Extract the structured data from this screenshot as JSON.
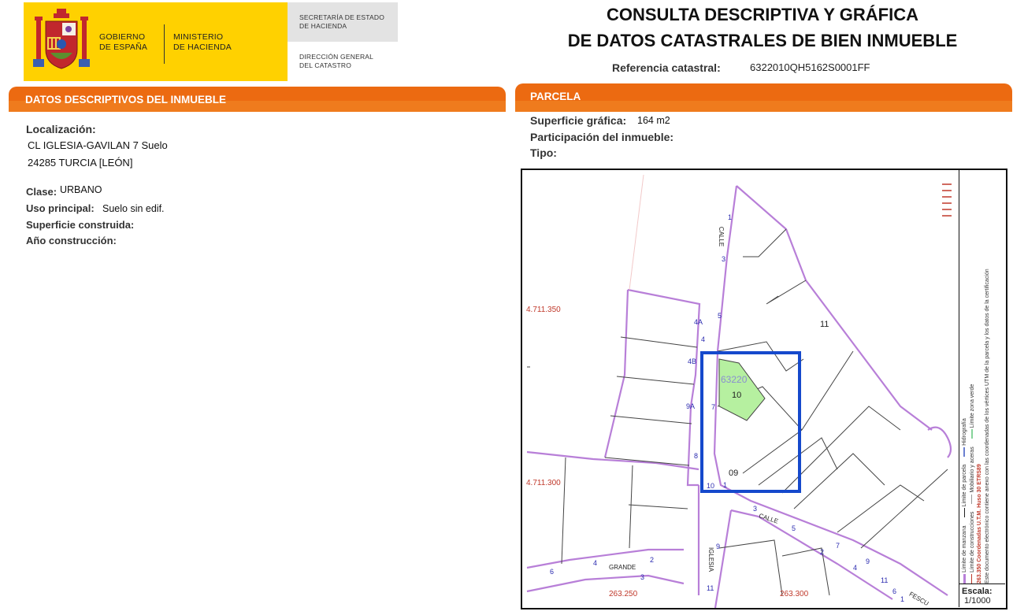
{
  "header": {
    "gov_line1": "GOBIERNO",
    "gov_line2": "DE ESPAÑA",
    "ministry_line1": "MINISTERIO",
    "ministry_line2": "DE HACIENDA",
    "secretaria_line1": "SECRETARÍA DE ESTADO",
    "secretaria_line2": "DE HACIENDA",
    "direccion_line1": "DIRECCIÓN GENERAL",
    "direccion_line2": "DEL CATASTRO",
    "title_line1": "CONSULTA DESCRIPTIVA Y GRÁFICA",
    "title_line2": "DE DATOS CATASTRALES DE BIEN INMUEBLE",
    "ref_label": "Referencia catastral:",
    "ref_value": "6322010QH5162S0001FF"
  },
  "descriptivos": {
    "section_title": "DATOS DESCRIPTIVOS DEL INMUEBLE",
    "localizacion_label": "Localización:",
    "address_line1": "CL IGLESIA-GAVILAN 7 Suelo",
    "address_line2": "24285 TURCIA [LEÓN]",
    "clase_label": "Clase:",
    "clase_value": "URBANO",
    "uso_label": "Uso principal:",
    "uso_value": "Suelo sin edif.",
    "superficie_label": "Superficie construida:",
    "anio_label": "Año construcción:"
  },
  "parcela": {
    "section_title": "PARCELA",
    "superficie_label": "Superficie gráfica:",
    "superficie_value": "164 m2",
    "participacion_label": "Participación del inmueble:",
    "tipo_label": "Tipo:"
  },
  "map": {
    "coord_y1": "4.711.350",
    "coord_y2": "4.711.300",
    "coord_x1": "263.250",
    "coord_x2": "263.300",
    "parcel_id": "63220",
    "parcel_no": "10",
    "parcel_c9": "09",
    "plot_11": "11",
    "street_calle_top": "CALLE",
    "street_calle_mid": "CALLE",
    "street_grande": "GRANDE",
    "street_iglesia": "IGLESIA",
    "street_fesco": "FESCU",
    "numbers": [
      "1",
      "3",
      "5",
      "4",
      "4A",
      "4B",
      "7",
      "9A",
      "8",
      "10",
      "1",
      "3",
      "5",
      "2",
      "7",
      "4",
      "9",
      "11",
      "6",
      "4",
      "2",
      "3",
      "9",
      "11",
      "6",
      "1"
    ],
    "legend_line1": "Límite de manzana",
    "legend_line2": "Límite de parcela",
    "legend_line3": "Hidrografía",
    "legend_line4": "Límite de construcciones",
    "legend_line5": "Mobiliario y aceras",
    "legend_line6": "Límite zona verde",
    "legend_coords": "263.350 Coordenadas U.T.M. Huso 30 ETRS89",
    "legend_note": "Este documento electrónico contiene anexo con las coordenadas de los vértices UTM de la parcela y los datos de la certificación",
    "scale_label": "Escala:",
    "scale_value": "1/1000",
    "colors": {
      "parcel_fill": "#b6f0a0",
      "highlight": "#1549cc",
      "manzana": "#b87fd8",
      "coord_red": "#c0392b"
    }
  }
}
